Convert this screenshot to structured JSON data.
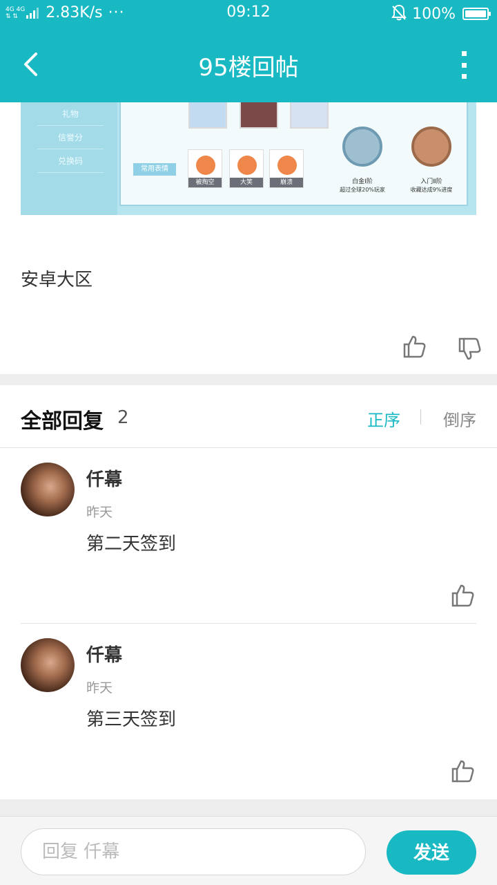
{
  "status_bar": {
    "network_top": "4G 4G",
    "network_bottom": "⇅ ⇅",
    "speed": "2.83K/s",
    "dots": "···",
    "time": "09:12",
    "battery": "100%",
    "battery_level": 1.0,
    "icons": [
      "signal-icon",
      "bell-muted-icon",
      "battery-icon"
    ]
  },
  "navbar": {
    "title": "95楼回帖",
    "icons": [
      "back-arrow-icon",
      "more-vertical-icon"
    ]
  },
  "post_image": {
    "sidebar_items": [
      "礼物",
      "信誉分",
      "兑换码"
    ],
    "emoji_section_label": "常用表情",
    "emojis": [
      "被掏空",
      "大笑",
      "崩溃"
    ],
    "badges": [
      {
        "label": "白金Ⅰ阶",
        "sub": "超过全球20%玩家"
      },
      {
        "label": "入门Ⅱ阶",
        "sub": "收藏达成9%进度"
      }
    ]
  },
  "post": {
    "text": "安卓大区",
    "icons": [
      "thumbs-up-icon",
      "thumbs-down-icon"
    ]
  },
  "replies": {
    "title": "全部回复",
    "count": "2",
    "sort_asc": "正序",
    "sort_desc": "倒序",
    "items": [
      {
        "name": "仟幕",
        "time": "昨天",
        "text": "第二天签到"
      },
      {
        "name": "仟幕",
        "time": "昨天",
        "text": "第三天签到"
      }
    ]
  },
  "input": {
    "placeholder": "回复 仟幕",
    "value": "",
    "send_label": "发送"
  },
  "colors": {
    "accent": "#19b9c4",
    "background": "#ffffff",
    "divider": "#eeeeee"
  }
}
